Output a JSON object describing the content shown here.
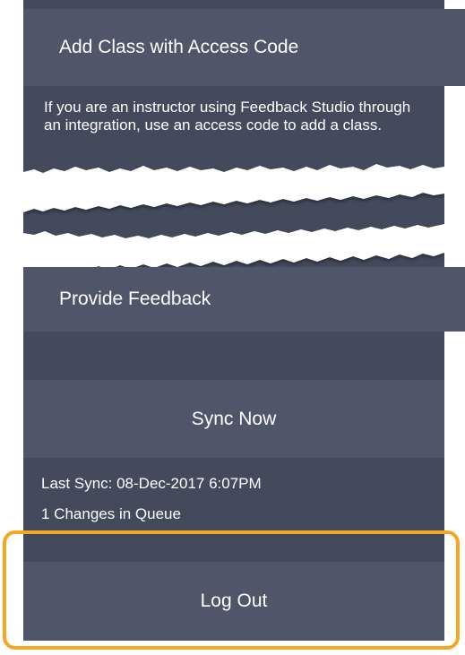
{
  "menu": {
    "add_class_label": "Add Class with Access Code",
    "add_class_note": "If you are an instructor using Feedback Studio through an integration, use an access code to add a class.",
    "provide_feedback_label": "Provide Feedback",
    "sync_now_label": "Sync Now",
    "last_sync": "Last Sync: 08-Dec-2017 6:07PM",
    "queue_status": "1 Changes in Queue",
    "log_out_label": "Log Out"
  },
  "colors": {
    "row": "#505669",
    "section_background": "#434a5c",
    "text": "#ffffff",
    "highlight": "#f5a623"
  }
}
